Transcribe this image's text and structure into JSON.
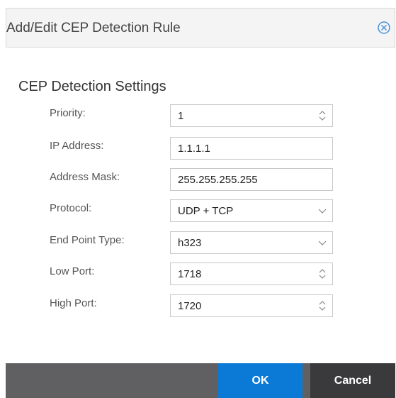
{
  "dialog": {
    "title": "Add/Edit CEP Detection Rule",
    "close_icon": "circle-x-icon"
  },
  "section": {
    "title": "CEP Detection Settings"
  },
  "fields": [
    {
      "label": "Priority:",
      "value": "1",
      "control": "spinner"
    },
    {
      "label": "IP Address:",
      "value": "1.1.1.1",
      "control": "text"
    },
    {
      "label": "Address Mask:",
      "value": "255.255.255.255",
      "control": "text"
    },
    {
      "label": "Protocol:",
      "value": "UDP + TCP",
      "control": "dropdown"
    },
    {
      "label": "End Point Type:",
      "value": "h323",
      "control": "dropdown"
    },
    {
      "label": "Low Port:",
      "value": "1718",
      "control": "spinner"
    },
    {
      "label": "High Port:",
      "value": "1720",
      "control": "spinner"
    }
  ],
  "buttons": {
    "ok": "OK",
    "cancel": "Cancel"
  },
  "colors": {
    "accent": "#0a7ad6",
    "footer": "#606062",
    "cancel": "#3a3a3c"
  }
}
